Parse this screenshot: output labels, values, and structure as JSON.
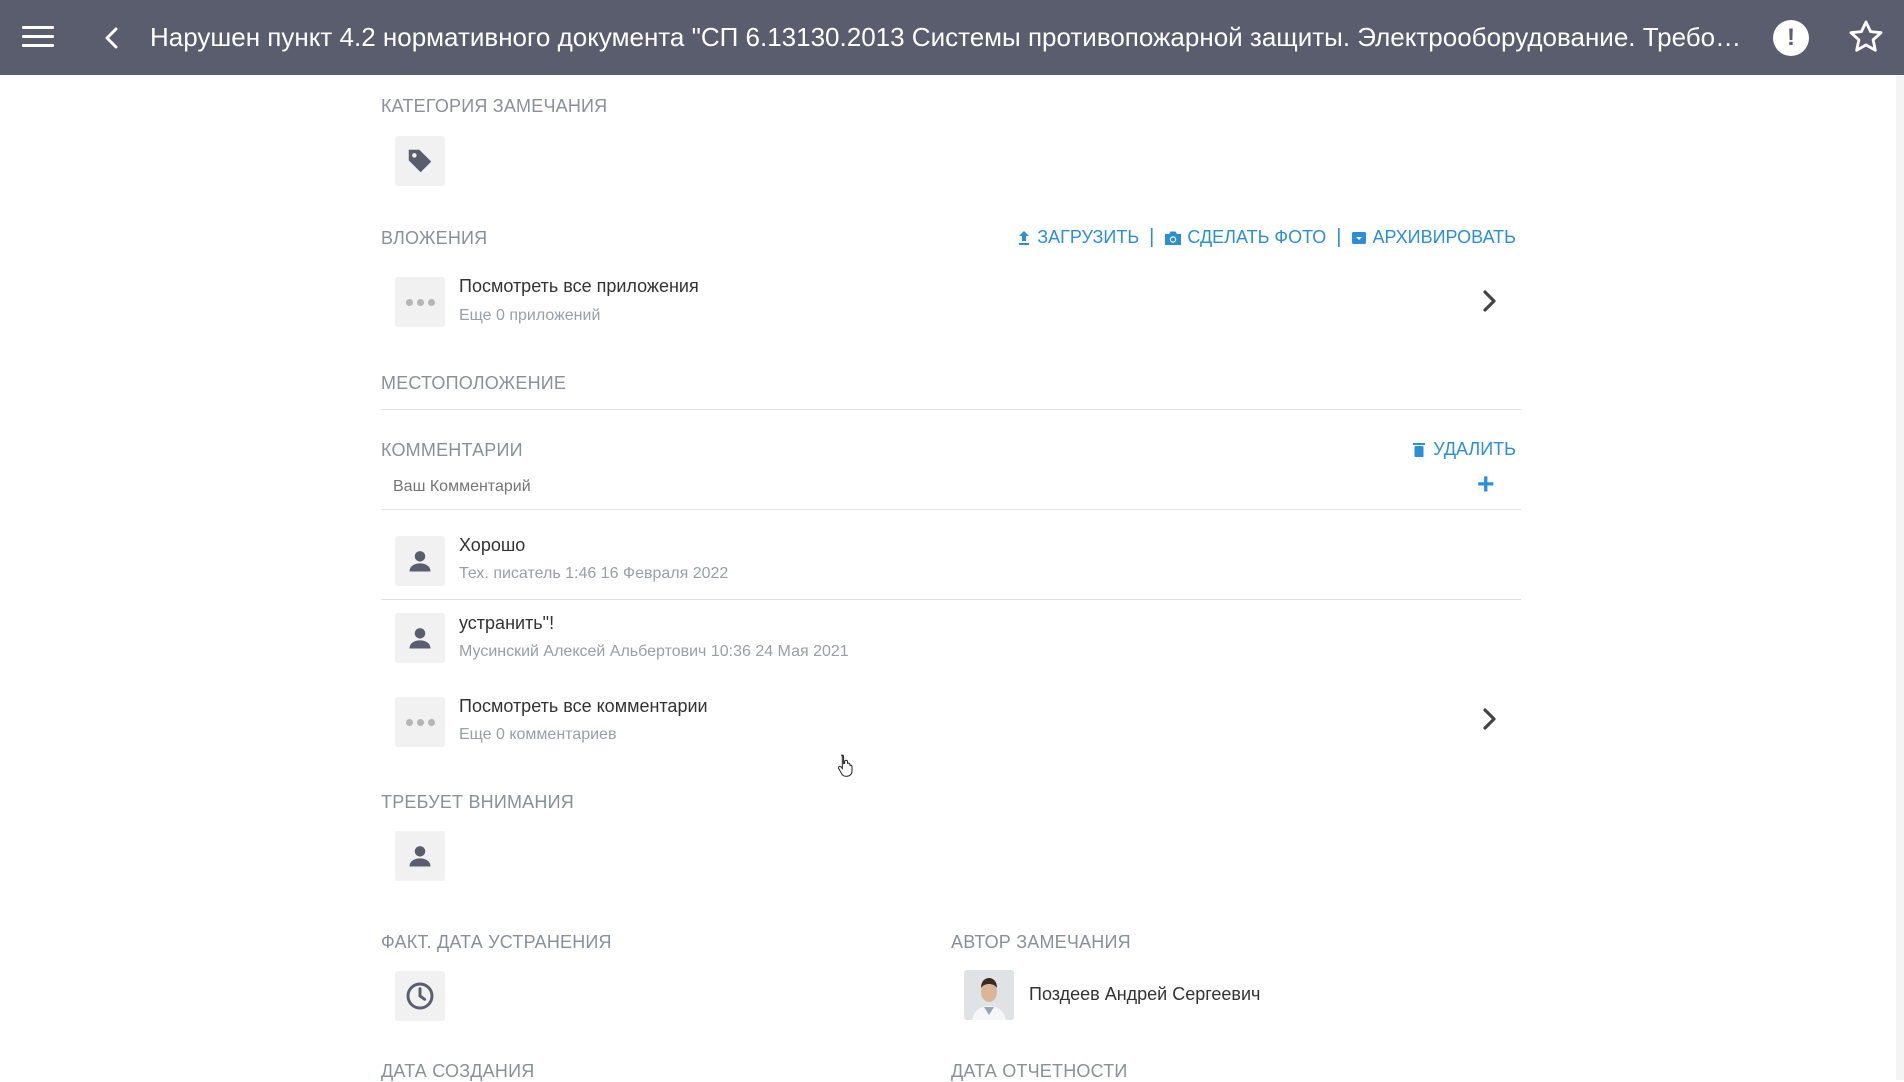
{
  "header": {
    "title": "Нарушен пункт 4.2 нормативного документа \"СП 6.13130.2013 Системы противопожарной защиты. Электрооборудование. Требо…",
    "menu_icon": "hamburger-icon",
    "back_icon": "chevron-left-icon",
    "alert_glyph": "!",
    "favorite_icon": "star-outline-icon",
    "background_color": "#595d6e"
  },
  "category": {
    "label": "КАТЕГОРИЯ ЗАМЕЧАНИЯ",
    "icon": "tag-icon"
  },
  "attachments": {
    "label": "ВЛОЖЕНИЯ",
    "upload_label": "ЗАГРУЗИТЬ",
    "photo_label": "СДЕЛАТЬ ФОТО",
    "archive_label": "АРХИВИРОВАТЬ",
    "separator": "|",
    "view_all_title": "Посмотреть все приложения",
    "view_all_sub": "Еще 0 приложений",
    "accent_color": "#2b8fd6"
  },
  "location": {
    "label": "МЕСТОПОЛОЖЕНИЕ"
  },
  "comments": {
    "label": "КОММЕНТАРИИ",
    "delete_label": "УДАЛИТЬ",
    "input_placeholder": "Ваш Комментарий",
    "add_glyph": "+",
    "items": [
      {
        "text": "Хорошо",
        "meta": "Тех. писатель 1:46 16 Февраля 2022"
      },
      {
        "text": "устранить\"!",
        "meta": "Мусинский Алексей Альбертович 10:36 24 Мая 2021"
      }
    ],
    "view_all_title": "Посмотреть все комментарии",
    "view_all_sub": "Еще 0 комментариев"
  },
  "attention": {
    "label": "ТРЕБУЕТ ВНИМАНИЯ"
  },
  "fix_date": {
    "label": "ФАКТ. ДАТА УСТРАНЕНИЯ",
    "icon": "clock-icon"
  },
  "author": {
    "label": "АВТОР ЗАМЕЧАНИЯ",
    "name": "Поздеев Андрей Сергеевич"
  },
  "created": {
    "label": "ДАТА СОЗДАНИЯ"
  },
  "report_date": {
    "label": "ДАТА ОТЧЕТНОСТИ"
  }
}
